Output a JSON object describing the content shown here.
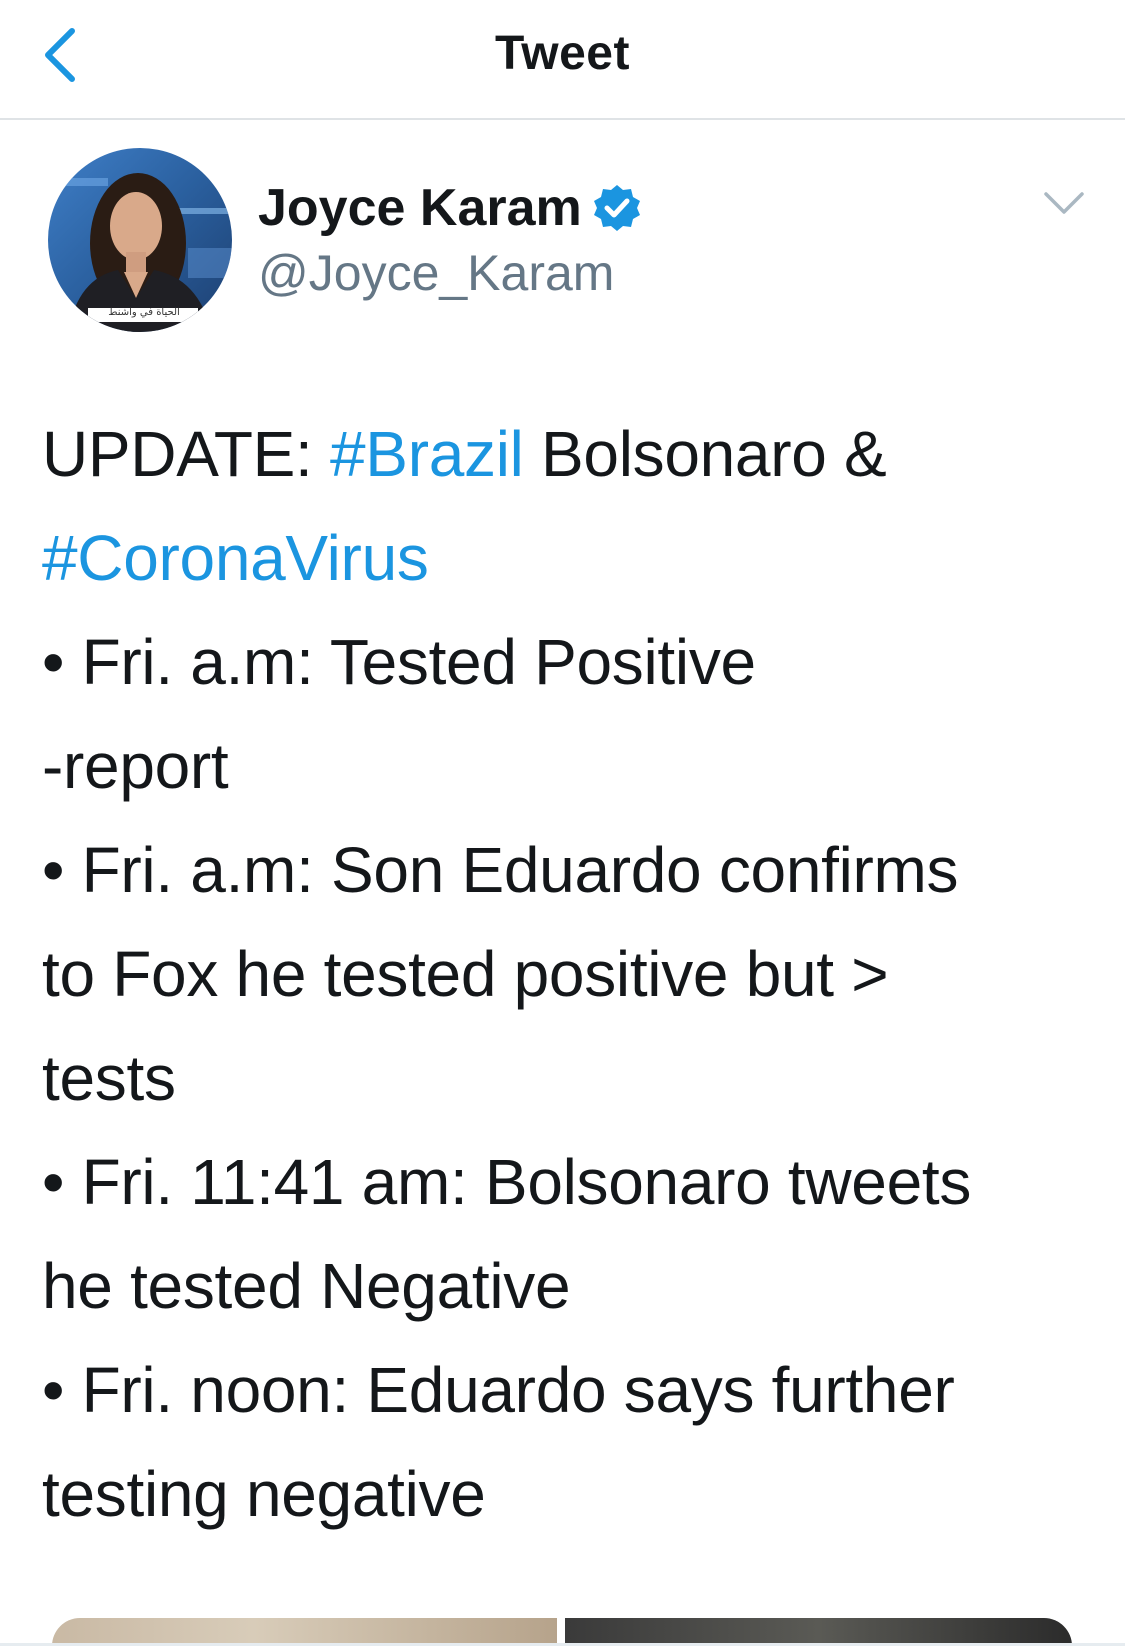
{
  "nav": {
    "title": "Tweet",
    "back_icon": "chevron-left-icon"
  },
  "author": {
    "display_name": "Joyce Karam",
    "handle": "@Joyce_Karam",
    "verified": true,
    "avatar_caption": "الحياة في واشنط"
  },
  "tweet": {
    "lines": [
      [
        {
          "text": "UPDATE: "
        },
        {
          "text": "#Brazil",
          "hashtag": true
        },
        {
          "text": " Bolsonaro &"
        }
      ],
      [
        {
          "text": "#CoronaVirus",
          "hashtag": true
        }
      ],
      [
        {
          "text": "• Fri. a.m: Tested Positive"
        }
      ],
      [
        {
          "text": "-report"
        }
      ],
      [
        {
          "text": "• Fri. a.m: Son Eduardo confirms"
        }
      ],
      [
        {
          "text": "to Fox he tested positive but >"
        }
      ],
      [
        {
          "text": "tests"
        }
      ],
      [
        {
          "text": "• Fri. 11:41 am: Bolsonaro tweets"
        }
      ],
      [
        {
          "text": "he tested Negative"
        }
      ],
      [
        {
          "text": "• Fri. noon: Eduardo says further"
        }
      ],
      [
        {
          "text": "testing negative"
        }
      ]
    ]
  },
  "colors": {
    "accent": "#1b95e0",
    "text": "#14171a",
    "secondary": "#657786",
    "divider": "#dfe3e6"
  }
}
